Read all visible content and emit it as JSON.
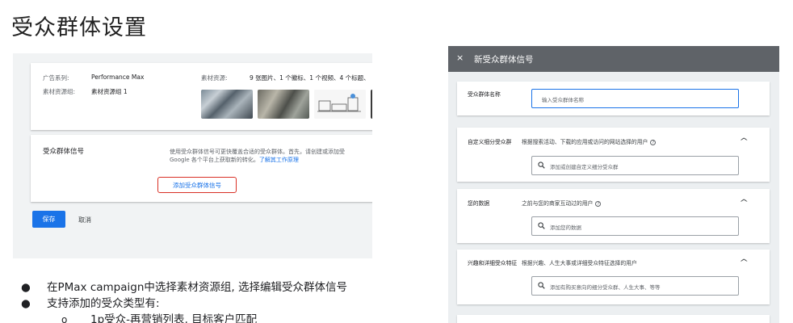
{
  "slide": {
    "title": "受众群体设置"
  },
  "left_screenshot": {
    "campaign_label": "广告系列:",
    "campaign_value": "Performance Max",
    "asset_group_label": "素材资源组:",
    "asset_group_value": "素材资源组 1",
    "assets_label": "素材资源:",
    "assets_value": "9 张图片、1 个徽标、1 个视频、4 个标题、",
    "audience_signal_title": "受众群体信号",
    "audience_signal_desc_line1": "使用受众群体信号可更快覆盖合适的受众群体。首先，请创建或添加受",
    "audience_signal_desc_line2_prefix": "Google 各个平台上获取新的转化。",
    "audience_signal_desc_link": "了解其工作原理",
    "add_signal_button": "添加受众群体信号",
    "save_button": "保存",
    "cancel_button": "取消"
  },
  "bullets": [
    {
      "marker": "●",
      "text": "在PMax campaign中选择素材资源组, 选择编辑受众群体信号"
    },
    {
      "marker": "●",
      "text": "支持添加的受众类型有:"
    }
  ],
  "sub_bullets": [
    {
      "marker": "o",
      "text": "1p受众-再营销列表, 目标客户匹配"
    }
  ],
  "dialog": {
    "close_icon": "×",
    "title": "新受众群体信号",
    "sections": [
      {
        "label": "受众群体名称",
        "placeholder": "输入受众群体名称"
      },
      {
        "label": "自定义细分受众群",
        "desc": "根据搜索活动、下载的应用或访问的网站选择的用户",
        "placeholder": "添加或创建自定义细分受众群"
      },
      {
        "label": "您的数据",
        "desc": "之前与您的商家互动过的用户",
        "placeholder": "添加您的数据"
      },
      {
        "label": "兴趣和详细受众特征",
        "desc": "根据兴趣、人生大事或详细受众特征选择的用户",
        "placeholder": "添加有购买意向的细分受众群、人生大事、等等"
      }
    ],
    "help_icon": "?",
    "chevron_icon": "^"
  },
  "colors": {
    "accent": "#1a73e8",
    "highlight_border": "#d93025",
    "dialog_header": "#5f6368"
  }
}
